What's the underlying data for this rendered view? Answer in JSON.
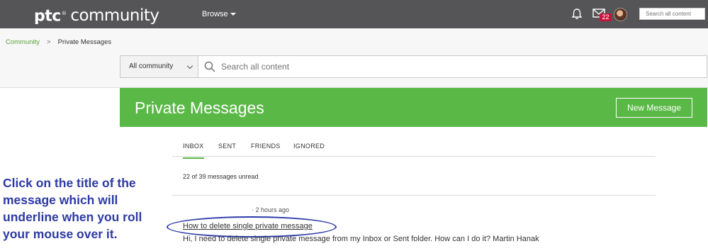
{
  "topbar": {
    "logo_ptc": "ptc",
    "logo_community": "community",
    "browse_label": "Browse",
    "mail_count": "22",
    "search_placeholder": "Search all content",
    "bg_color": "#555557"
  },
  "breadcrumb": {
    "root": "Community",
    "separator": ">",
    "current": "Private Messages"
  },
  "search": {
    "scope": "All community",
    "placeholder": "Search all content"
  },
  "banner": {
    "title": "Private Messages",
    "new_button": "New Message",
    "color": "#5ab946"
  },
  "tabs": [
    {
      "label": "INBOX",
      "active": true
    },
    {
      "label": "SENT",
      "active": false
    },
    {
      "label": "FRIENDS",
      "active": false
    },
    {
      "label": "IGNORED",
      "active": false
    }
  ],
  "inbox": {
    "unread_summary": "22 of 39 messages unread",
    "messages": [
      {
        "time": "· 2 hours ago",
        "title": "How to delete single private message",
        "snippet": "Hi,   I need to delete single private message from my Inbox or Sent folder. How can I do it?   Martin Hanak"
      }
    ]
  },
  "annotation": {
    "text": "Click on the title of the message which will underline when you roll your mouse over it.",
    "color": "#2d3aa3"
  }
}
